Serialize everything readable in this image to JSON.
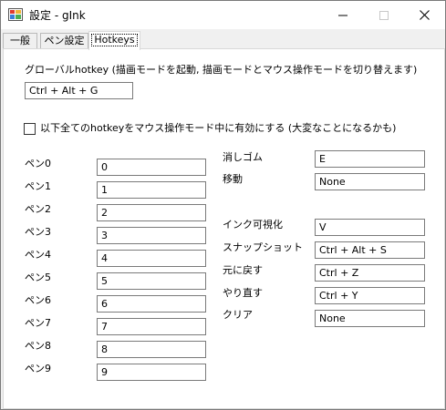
{
  "window": {
    "title": "設定 - gInk"
  },
  "tabs": [
    {
      "label": "一般"
    },
    {
      "label": "ペン設定"
    },
    {
      "label": "Hotkeys"
    }
  ],
  "global": {
    "label": "グローバルhotkey (描画モードを起動, 描画モードとマウス操作モードを切り替えます)",
    "value": "Ctrl + Alt + G"
  },
  "mouse_mode_checkbox": {
    "label": "以下全てのhotkeyをマウス操作モード中に有効にする (大変なことになるかも)",
    "checked": false
  },
  "pens": [
    {
      "label": "ペン0",
      "value": "0"
    },
    {
      "label": "ペン1",
      "value": "1"
    },
    {
      "label": "ペン2",
      "value": "2"
    },
    {
      "label": "ペン3",
      "value": "3"
    },
    {
      "label": "ペン4",
      "value": "4"
    },
    {
      "label": "ペン5",
      "value": "5"
    },
    {
      "label": "ペン6",
      "value": "6"
    },
    {
      "label": "ペン7",
      "value": "7"
    },
    {
      "label": "ペン8",
      "value": "8"
    },
    {
      "label": "ペン9",
      "value": "9"
    }
  ],
  "tools": [
    {
      "label": "消しゴム",
      "value": "E"
    },
    {
      "label": "移動",
      "value": "None"
    },
    {
      "label": "インク可視化",
      "value": "V"
    },
    {
      "label": "スナップショット",
      "value": "Ctrl + Alt + S"
    },
    {
      "label": "元に戻す",
      "value": "Ctrl + Z"
    },
    {
      "label": "やり直す",
      "value": "Ctrl + Y"
    },
    {
      "label": "クリア",
      "value": "None"
    }
  ]
}
